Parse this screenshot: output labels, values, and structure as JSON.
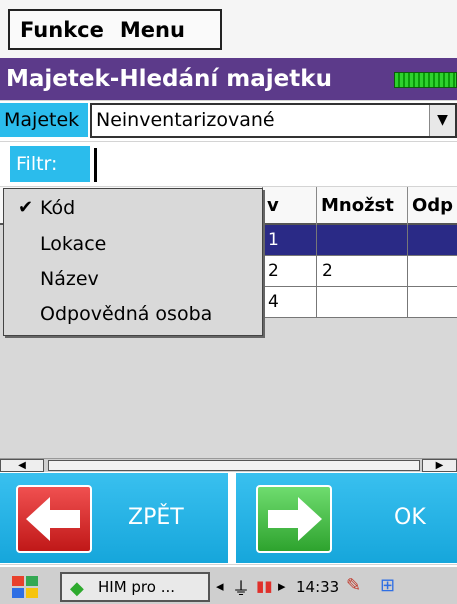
{
  "menubar": {
    "items": [
      "Funkce",
      "Menu"
    ]
  },
  "window": {
    "title": "Majetek-Hledání majetku"
  },
  "majetek": {
    "label": "Majetek",
    "value": "Neinventarizované"
  },
  "filter": {
    "label": "Filtr:",
    "value": ""
  },
  "grid": {
    "columns": [
      "",
      "v",
      "Množst",
      "Odp"
    ],
    "rows": [
      {
        "v": "1",
        "mnozstvi": "",
        "selected": true
      },
      {
        "v": "2",
        "mnozstvi": "2",
        "selected": false
      },
      {
        "v": "4",
        "mnozstvi": "",
        "selected": false
      }
    ]
  },
  "dropdown": {
    "items": [
      {
        "label": "Kód",
        "checked": true
      },
      {
        "label": "Lokace",
        "checked": false
      },
      {
        "label": "Název",
        "checked": false
      },
      {
        "label": "Odpovědná osoba",
        "checked": false
      }
    ]
  },
  "buttons": {
    "back": "ZPĚT",
    "ok": "OK"
  },
  "taskbar": {
    "app": "HIM pro ...",
    "time": "14:33"
  },
  "colors": {
    "title_bg": "#5c3a8a",
    "accent": "#2bbcec",
    "selected_row": "#2a2a86"
  }
}
